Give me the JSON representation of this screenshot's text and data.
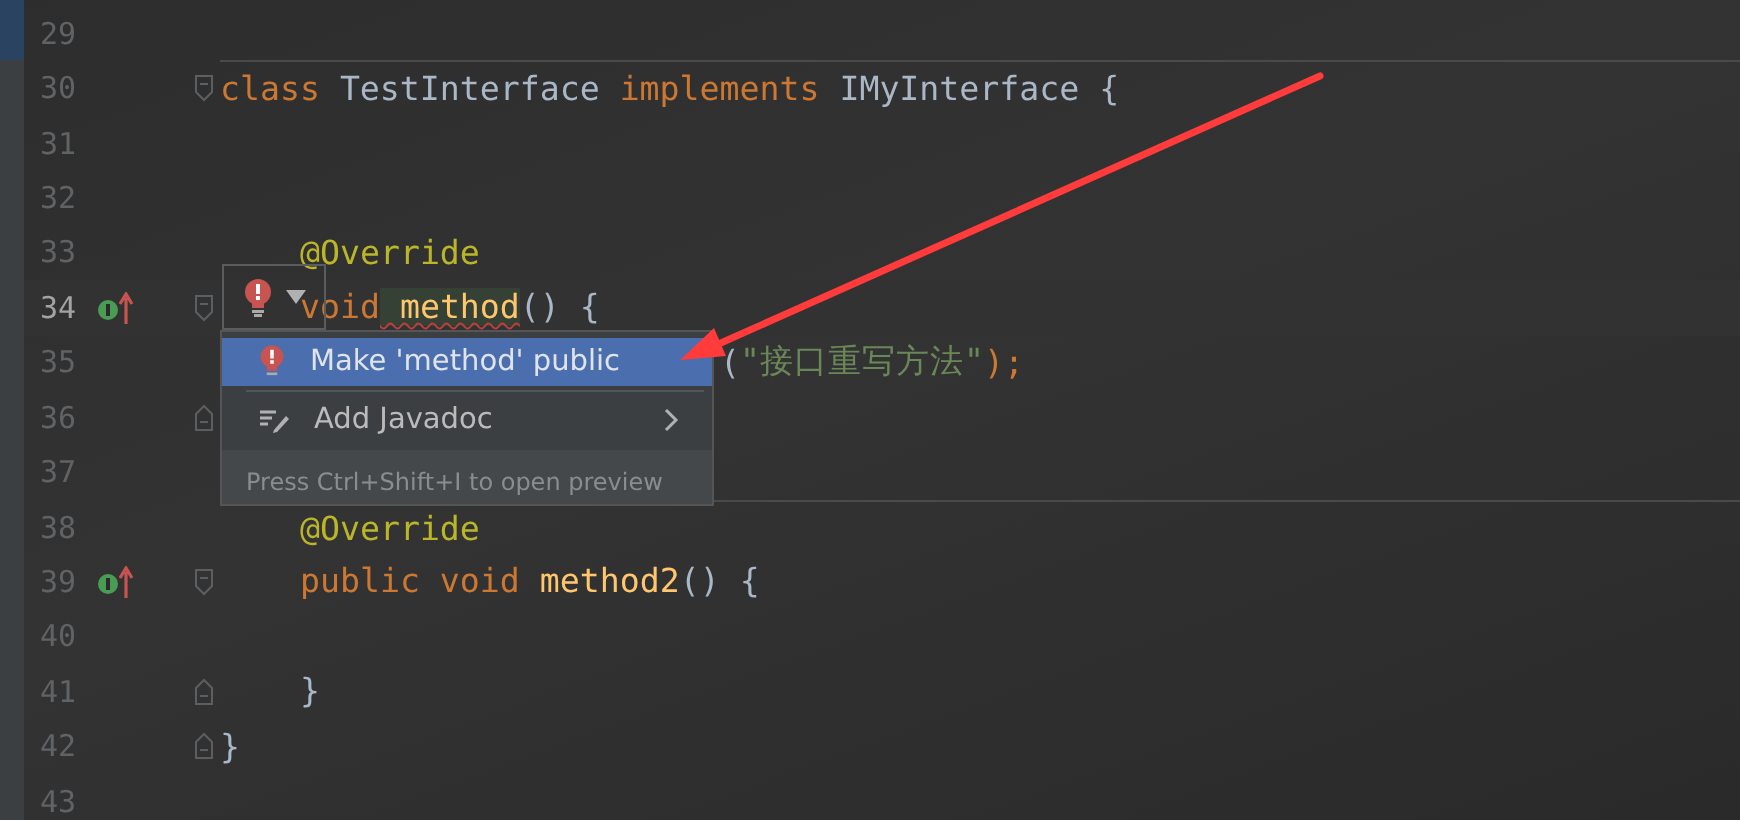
{
  "editor": {
    "lines": [
      {
        "number": "29",
        "kind": "code",
        "current": false,
        "separator": false
      },
      {
        "number": "30",
        "kind": "code",
        "current": false,
        "separator": true,
        "fold_start": true,
        "tokens": [
          {
            "text": "class",
            "kind": "keyword"
          },
          {
            "text": " TestInterface ",
            "kind": "plain"
          },
          {
            "text": "implements",
            "kind": "keyword"
          },
          {
            "text": " IMyInterface {",
            "kind": "plain"
          }
        ],
        "children": [
          {
            "number": "31",
            "kind": "code",
            "current": false,
            "separator": false
          },
          {
            "number": "32",
            "kind": "code",
            "current": false,
            "separator": false
          },
          {
            "number": "33",
            "kind": "code",
            "current": false,
            "separator": false,
            "tokens": [
              {
                "text": "@Override",
                "kind": "annotation"
              }
            ]
          },
          {
            "number": "34",
            "kind": "code",
            "current": true,
            "separator": false,
            "implements_marker": true,
            "fold_start": true,
            "tokens": [
              {
                "text": "void",
                "kind": "keyword"
              },
              {
                "text": " method",
                "kind": "error"
              },
              {
                "text": "() {",
                "kind": "plain"
              }
            ],
            "children": [
              {
                "number": "35",
                "kind": "covered",
                "current": false,
                "separator": false,
                "tokens": [
                  {
                    "text": "(",
                    "kind": "plain"
                  },
                  {
                    "text": "\"接口重写方法\"",
                    "kind": "string"
                  },
                  {
                    "text": ");",
                    "kind": "keyword"
                  }
                ]
              }
            ]
          },
          {
            "number": "36",
            "kind": "code",
            "current": false,
            "separator": false,
            "fold_end": true
          },
          {
            "number": "37",
            "kind": "code",
            "current": false,
            "separator": false
          },
          {
            "number": "38",
            "kind": "code",
            "current": false,
            "separator": true,
            "tokens": [
              {
                "text": "@Override",
                "kind": "annotation"
              }
            ]
          },
          {
            "number": "39",
            "kind": "code",
            "current": false,
            "separator": false,
            "implements_marker": true,
            "fold_start": true,
            "tokens": [
              {
                "text": "public void",
                "kind": "keyword"
              },
              {
                "text": " method2",
                "kind": "method"
              },
              {
                "text": "() {",
                "kind": "plain"
              }
            ],
            "children": [
              {
                "number": "40",
                "kind": "code",
                "current": false,
                "separator": false
              }
            ]
          },
          {
            "number": "41",
            "kind": "code",
            "current": false,
            "separator": false,
            "fold_end": true,
            "tokens": [
              {
                "text": "}",
                "kind": "plain"
              }
            ]
          }
        ]
      },
      {
        "number": "42",
        "kind": "code",
        "current": false,
        "separator": false,
        "fold_end": true,
        "tokens": [
          {
            "text": "}",
            "kind": "plain"
          }
        ]
      },
      {
        "number": "43",
        "kind": "code",
        "current": false,
        "separator": false
      }
    ]
  },
  "intention_popup": {
    "items": [
      {
        "label": "Make 'method' public",
        "kind": "fix",
        "selected": true,
        "submenu": false
      },
      {
        "label": "Add Javadoc",
        "kind": "doc",
        "selected": false,
        "submenu": true
      }
    ],
    "hint": "Press Ctrl+Shift+I to open preview"
  }
}
